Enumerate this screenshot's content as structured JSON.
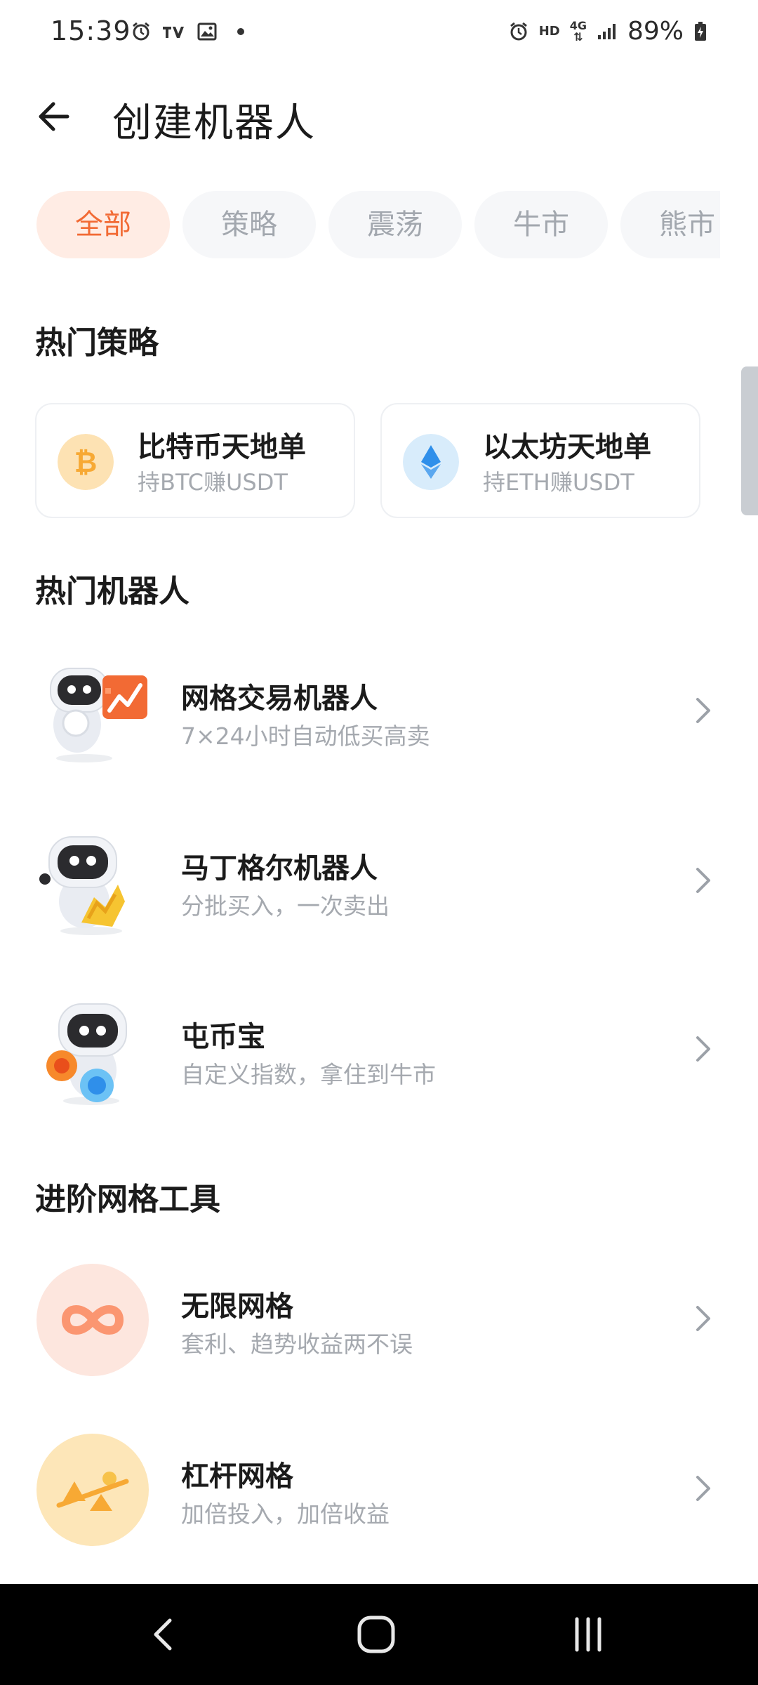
{
  "status_bar": {
    "time": "15:39",
    "battery": "89%",
    "network_hd": "HD",
    "network_type": "4G",
    "left_icons": [
      "alarm-icon",
      "tv-app-icon",
      "gallery-icon",
      "dot-icon"
    ],
    "right_icons": [
      "alarm-icon",
      "hd-icon",
      "4g-icon",
      "signal-icon",
      "battery-charging-icon"
    ]
  },
  "header": {
    "title": "创建机器人",
    "back_icon": "arrow-left-icon"
  },
  "tabs": [
    {
      "label": "全部",
      "active": true
    },
    {
      "label": "策略",
      "active": false
    },
    {
      "label": "震荡",
      "active": false
    },
    {
      "label": "牛市",
      "active": false
    },
    {
      "label": "熊市",
      "active": false
    }
  ],
  "hot_strategies": {
    "title": "热门策略",
    "items": [
      {
        "title": "比特币天地单",
        "subtitle": "持BTC赚USDT",
        "icon": "bitcoin-icon",
        "color": "#f7a934"
      },
      {
        "title": "以太坊天地单",
        "subtitle": "持ETH赚USDT",
        "icon": "ethereum-icon",
        "color": "#2f8fea"
      }
    ]
  },
  "hot_robots": {
    "title": "热门机器人",
    "items": [
      {
        "title": "网格交易机器人",
        "subtitle": "7×24小时自动低买高卖",
        "icon": "grid-trading-robot-icon"
      },
      {
        "title": "马丁格尔机器人",
        "subtitle": "分批买入，一次卖出",
        "icon": "martingale-robot-icon"
      },
      {
        "title": "屯币宝",
        "subtitle": "自定义指数，拿住到牛市",
        "icon": "hodl-robot-icon"
      }
    ]
  },
  "advanced_grid": {
    "title": "进阶网格工具",
    "items": [
      {
        "title": "无限网格",
        "subtitle": "套利、趋势收益两不误",
        "icon": "infinity-icon"
      },
      {
        "title": "杠杆网格",
        "subtitle": "加倍投入，加倍收益",
        "icon": "leverage-shapes-icon"
      }
    ]
  },
  "navbar": {
    "icons": [
      "nav-back-icon",
      "nav-home-icon",
      "nav-recents-icon"
    ]
  },
  "colors": {
    "accent": "#f26a34",
    "accent_bg": "#ffece4",
    "text_primary": "#1b1b1b",
    "text_secondary": "#a5a9af"
  }
}
